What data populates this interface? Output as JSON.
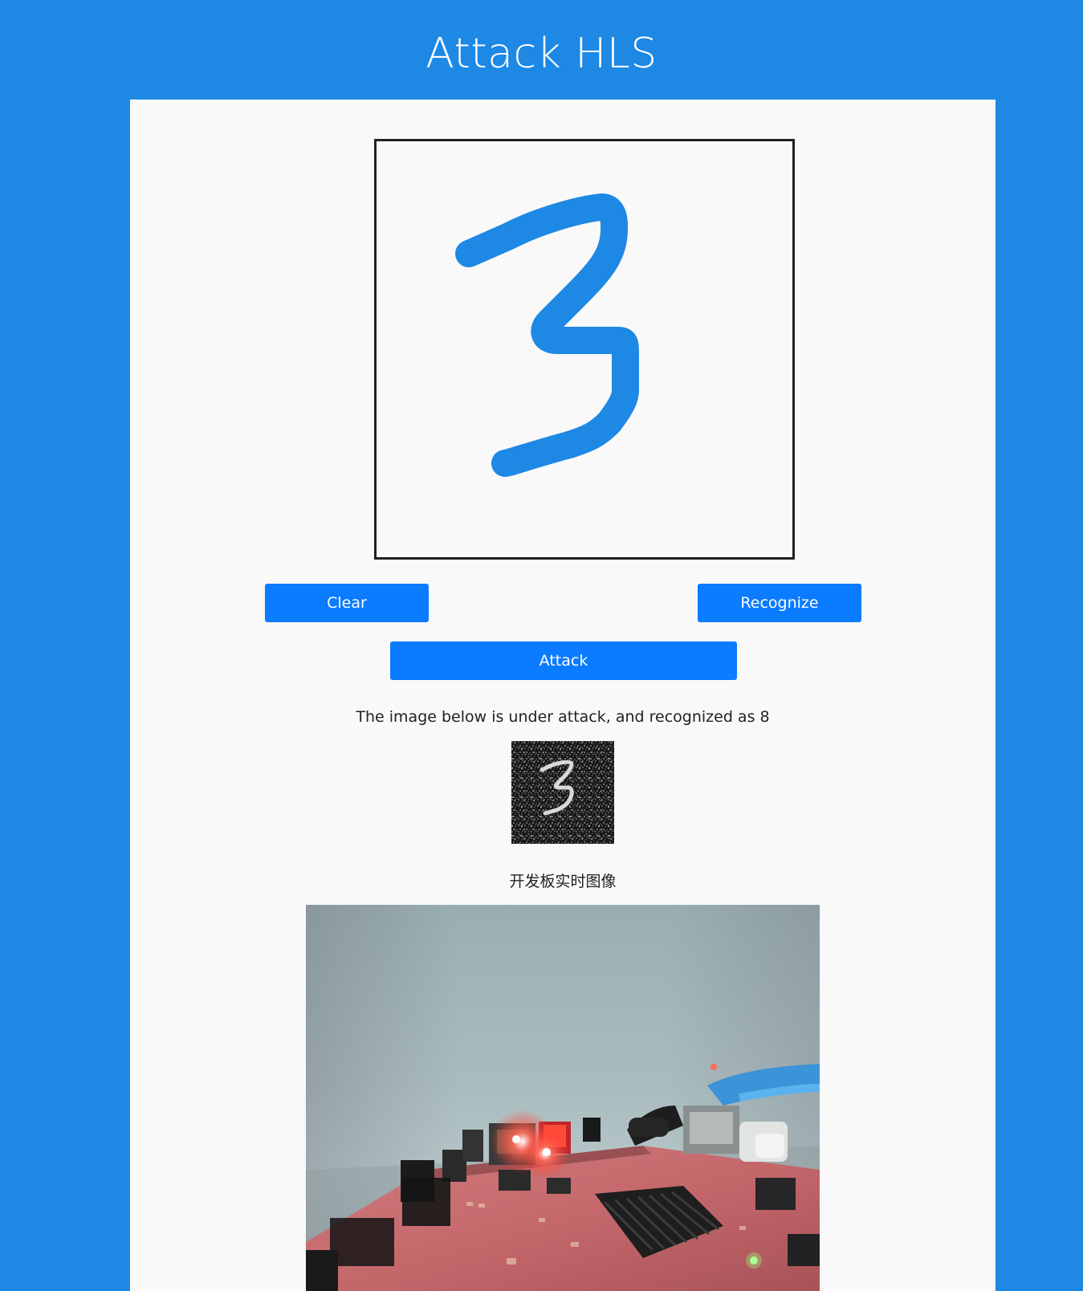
{
  "header": {
    "title": "Attack HLS"
  },
  "drawing_canvas": {
    "stroke_color": "#1e88e5",
    "drawn_digit": "3"
  },
  "buttons": {
    "clear_label": "Clear",
    "recognize_label": "Recognize",
    "attack_label": "Attack"
  },
  "result": {
    "status_text": "The image below is under attack, and recognized as 8"
  },
  "live_feed": {
    "label": "开发板实时图像"
  },
  "colors": {
    "page_background": "#1e88e5",
    "panel_background": "#f9f9f9",
    "button_background": "#0b7bff",
    "button_text": "#ffffff"
  }
}
